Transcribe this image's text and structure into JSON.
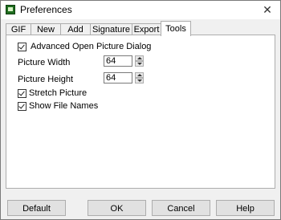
{
  "window": {
    "title": "Preferences",
    "close_glyph": "✕"
  },
  "tabs": [
    {
      "label": "GIF"
    },
    {
      "label": "New"
    },
    {
      "label": "Add"
    },
    {
      "label": "Signature"
    },
    {
      "label": "Export"
    },
    {
      "label": "Tools"
    }
  ],
  "active_tab": "Tools",
  "tools": {
    "advanced_open_picture_dialog": {
      "label": "Advanced Open Picture Dialog",
      "checked": true
    },
    "picture_width": {
      "label": "Picture Width",
      "value": "64"
    },
    "picture_height": {
      "label": "Picture Height",
      "value": "64"
    },
    "stretch_picture": {
      "label": "Stretch Picture",
      "checked": true
    },
    "show_file_names": {
      "label": "Show File Names",
      "checked": true
    }
  },
  "buttons": {
    "default": "Default",
    "ok": "OK",
    "cancel": "Cancel",
    "help": "Help"
  }
}
